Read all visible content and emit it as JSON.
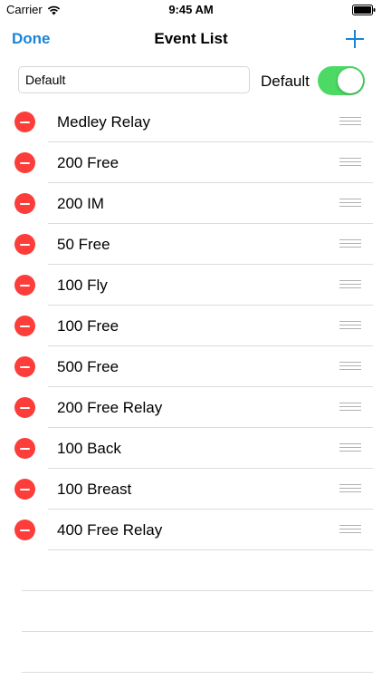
{
  "status_bar": {
    "carrier": "Carrier",
    "time": "9:45 AM"
  },
  "nav": {
    "left_button": "Done",
    "title": "Event List",
    "right_icon": "plus-icon"
  },
  "default_row": {
    "input_value": "Default",
    "toggle_label": "Default",
    "toggle_on": true
  },
  "events": [
    "Medley Relay",
    "200 Free",
    "200 IM",
    "50 Free",
    "100 Fly",
    "100 Free",
    "500 Free",
    "200 Free Relay",
    "100 Back",
    "100 Breast",
    "400 Free Relay"
  ],
  "colors": {
    "accent": "#1a84d8",
    "delete": "#fc3d39",
    "toggle_on": "#4cd964",
    "separator": "#dcdcdc"
  }
}
